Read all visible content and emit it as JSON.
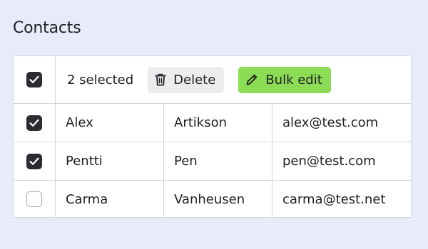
{
  "page": {
    "title": "Contacts"
  },
  "toolbar": {
    "selected_label": "2 selected",
    "delete_label": "Delete",
    "bulk_edit_label": "Bulk edit",
    "select_all_checked": true
  },
  "contacts": [
    {
      "first_name": "Alex",
      "last_name": "Artikson",
      "email": "alex@test.com",
      "checked": true
    },
    {
      "first_name": "Pentti",
      "last_name": "Pen",
      "email": "pen@test.com",
      "checked": true
    },
    {
      "first_name": "Carma",
      "last_name": "Vanheusen",
      "email": "carma@test.net",
      "checked": false
    }
  ],
  "icons": {
    "delete": "trash-icon",
    "bulk_edit": "pencil-icon",
    "checkbox": "checkmark-icon"
  },
  "colors": {
    "background": "#e9ebfb",
    "bulk_edit_button": "#8ddc55",
    "delete_button": "#ececef",
    "checkbox_checked": "#2b2b30",
    "border": "#d3d5db"
  }
}
